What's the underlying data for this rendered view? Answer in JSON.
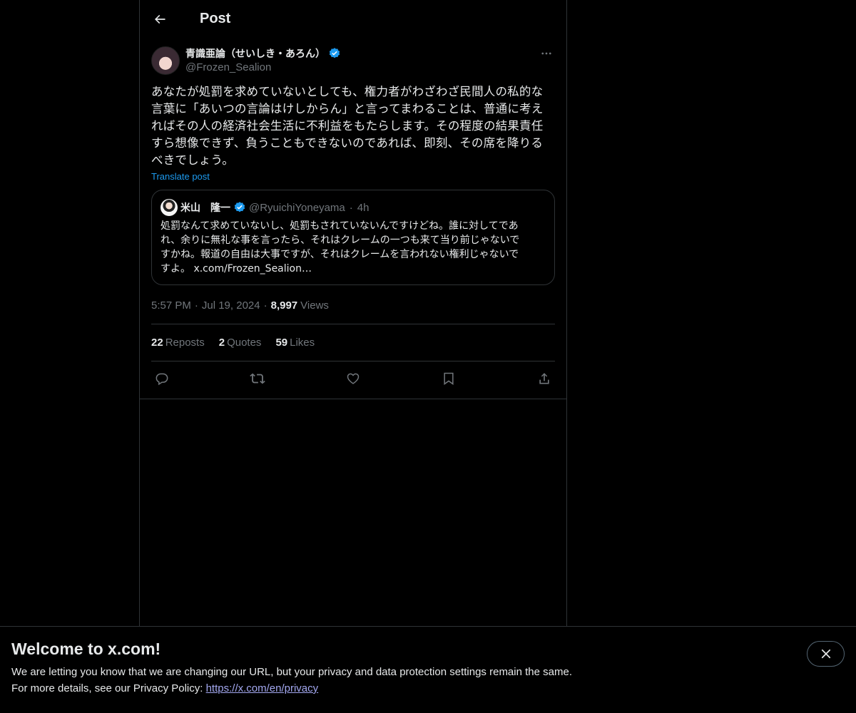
{
  "header": {
    "title": "Post"
  },
  "post": {
    "author_name": "青識亜論（せいしき・あろん）",
    "author_handle": "@Frozen_Sealion",
    "lines": [
      "あなたが処罰を求めていないとしても、権力者がわざわざ民間人の私的な",
      "言葉に「あいつの言論はけしからん」と言ってまわることは、普通に考え",
      "ればその人の経済社会生活に不利益をもたらします。その程度の結果責任",
      "すら想像できず、負うこともできないのであれば、即刻、その席を降りる",
      "べきでしょう。"
    ],
    "translate_label": "Translate post",
    "quote": {
      "name": "米山　隆一",
      "handle": "@RyuichiYoneyama",
      "dot": "·",
      "time": "4h",
      "lines": [
        "処罰なんて求めていないし、処罰もされていないんですけどね。誰に対してであ",
        "れ、余りに無礼な事を言ったら、それはクレームの一つも来て当り前じゃないで",
        "すかね。報道の自由は大事ですが、それはクレームを言われない権利じゃないで",
        "すよ。 x.com/Frozen_Sealion…"
      ]
    },
    "time": "5:57 PM",
    "date": "Jul 19, 2024",
    "sep": "·",
    "views_count": "8,997",
    "views_label": "Views",
    "stats": {
      "reposts_count": "22",
      "reposts_label": "Reposts",
      "quotes_count": "2",
      "quotes_label": "Quotes",
      "likes_count": "59",
      "likes_label": "Likes"
    }
  },
  "banner": {
    "title": "Welcome to x.com!",
    "line1": "We are letting you know that we are changing our URL, but your privacy and data protection settings remain the same.",
    "line2_prefix": "For more details, see our Privacy Policy: ",
    "link": "https://x.com/en/privacy"
  },
  "colors": {
    "accent": "#1d9bf0",
    "muted": "#71767b",
    "border": "#2f3336",
    "link": "#a3a8f0"
  }
}
